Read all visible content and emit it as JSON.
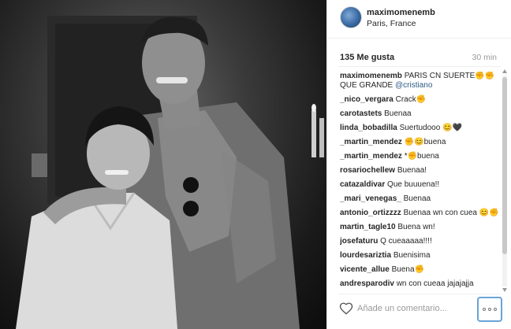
{
  "post": {
    "username": "maximomenemb",
    "location": "Paris, France",
    "likes": "135 Me gusta",
    "time": "30 min"
  },
  "caption": {
    "user": "maximomenemb",
    "text": "PARIS CN SUERTE✊✊ QUE GRANDE ",
    "mention": "@cristiano"
  },
  "comments": [
    {
      "user": "_nico_vergara",
      "text": "Crack✊"
    },
    {
      "user": "carotastets",
      "text": "Buenaa"
    },
    {
      "user": "linda_bobadilla",
      "text": "Suertudooo 😊🖤"
    },
    {
      "user": "_martin_mendez",
      "text": "✊😊buena"
    },
    {
      "user": "_martin_mendez",
      "text": "*✊buena"
    },
    {
      "user": "rosariochellew",
      "text": "Buenaa!"
    },
    {
      "user": "catazaldivar",
      "text": "Que buuuena!!"
    },
    {
      "user": "_mari_venegas_",
      "text": "Buenaa"
    },
    {
      "user": "antonio_ortizzzz",
      "text": "Buenaa wn con cuea 😊✊"
    },
    {
      "user": "martin_tagle10",
      "text": "Buena wn!"
    },
    {
      "user": "josefaturu",
      "text": "Q cueaaaaa!!!!"
    },
    {
      "user": "lourdesariztia",
      "text": "Buenisima"
    },
    {
      "user": "vicente_allue",
      "text": "Buena✊"
    },
    {
      "user": "andresparodiv",
      "text": "wn con cueaa jajajajja"
    }
  ],
  "footer": {
    "comment_placeholder": "Añade un comentario..."
  },
  "icons": {
    "like": "heart-icon",
    "more": "more-options-icon"
  },
  "colors": {
    "mention": "#2b5a83",
    "more_button_border": "#6aa4d8"
  }
}
